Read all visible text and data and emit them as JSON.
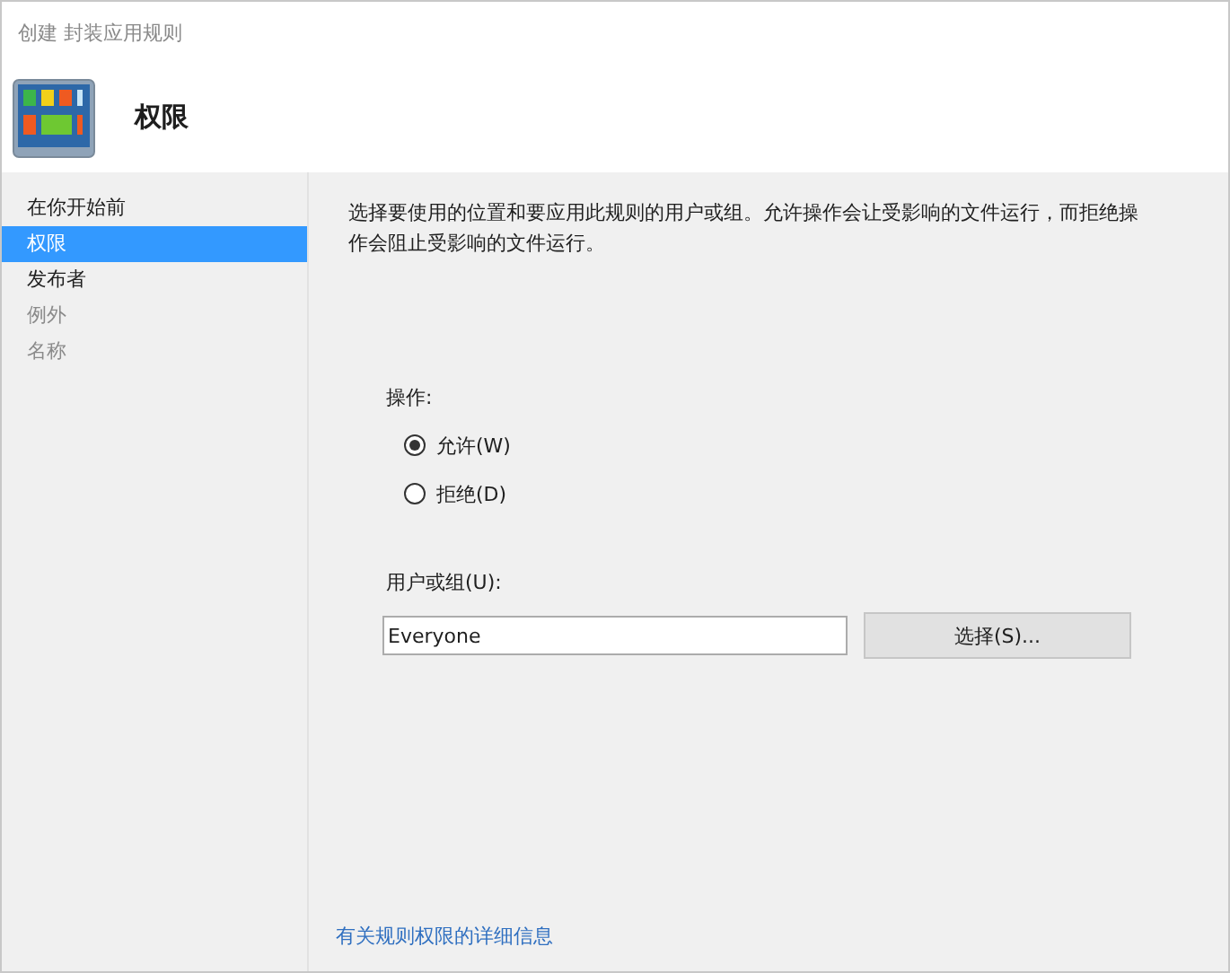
{
  "window": {
    "title": "创建 封装应用规则"
  },
  "header": {
    "title": "权限"
  },
  "sidebar": {
    "items": [
      {
        "label": "在你开始前",
        "selected": false,
        "disabled": false
      },
      {
        "label": "权限",
        "selected": true,
        "disabled": false
      },
      {
        "label": "发布者",
        "selected": false,
        "disabled": false
      },
      {
        "label": "例外",
        "selected": false,
        "disabled": true
      },
      {
        "label": "名称",
        "selected": false,
        "disabled": true
      }
    ]
  },
  "description": "选择要使用的位置和要应用此规则的用户或组。允许操作会让受影响的文件运行，而拒绝操作会阻止受影响的文件运行。",
  "action": {
    "label": "操作:",
    "options": [
      {
        "label": "允许(W)",
        "selected": true
      },
      {
        "label": "拒绝(D)",
        "selected": false
      }
    ]
  },
  "user_group": {
    "label": "用户或组(U):",
    "value": "Everyone",
    "button": "选择(S)..."
  },
  "link": "有关规则权限的详细信息"
}
